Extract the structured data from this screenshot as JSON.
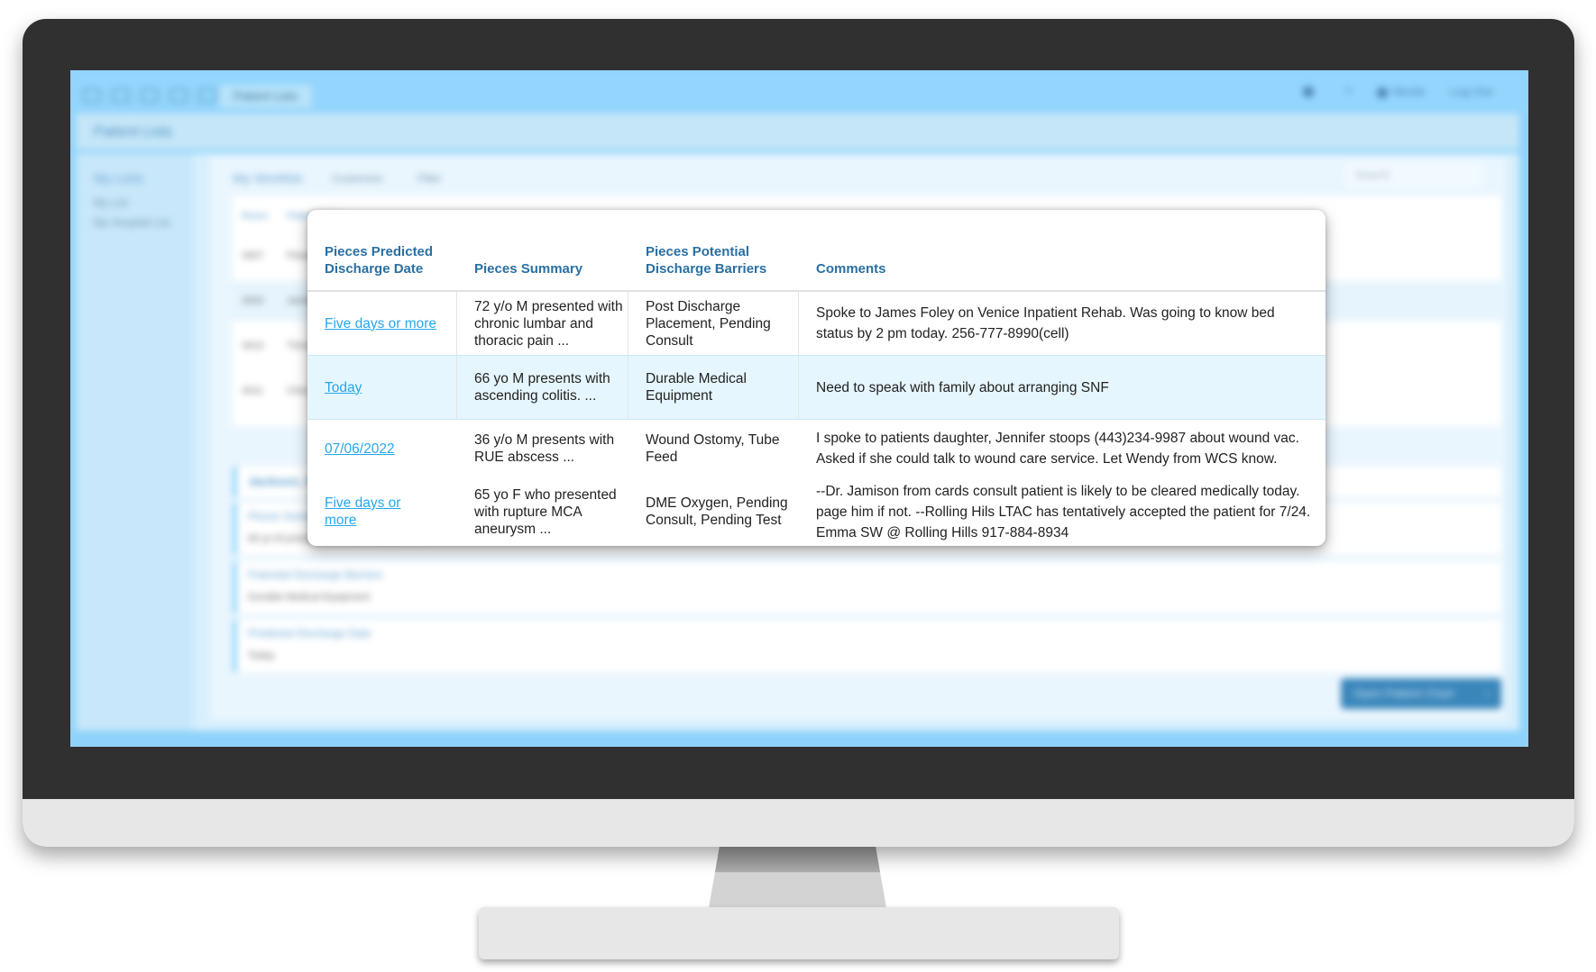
{
  "background_app": {
    "tab_label": "Patient Lists",
    "page_title": "Patient Lists",
    "top_right": {
      "user_label": "Nicole",
      "logout_label": "Log Out"
    },
    "sidebar": {
      "title": "My Lists",
      "items": [
        "My List",
        "My Hospital List"
      ]
    },
    "worklist": {
      "title": "My Worklist",
      "customize_label": "Customize",
      "filter_label": "Filter",
      "search_placeholder": "Search"
    },
    "table": {
      "headers": [
        "Room",
        "Patient Name"
      ],
      "rows": [
        {
          "room": "3407",
          "name": "Floan, C"
        },
        {
          "room": "3400",
          "name": "Jackson, F"
        },
        {
          "room": "3410",
          "name": "Thomas,"
        },
        {
          "room": "3411",
          "name": "Chen, K"
        }
      ]
    },
    "detail": {
      "patient_name": "Jackson, F",
      "cards": [
        {
          "label": "Pieces Summary",
          "value": "66 yo M presents with ascending colitis. ..."
        },
        {
          "label": "Potential Discharge Barriers",
          "value": "Durable Medical Equipment"
        },
        {
          "label": "Predicted Discharge Date",
          "value": "Today"
        }
      ],
      "open_chart_label": "Open Patient Chart"
    }
  },
  "popup": {
    "headers": {
      "discharge_date": "Pieces Predicted Discharge Date",
      "summary": "Pieces Summary",
      "barriers": "Pieces Potential Discharge Barriers",
      "comments": "Comments"
    },
    "rows": [
      {
        "discharge_date": "Five days or more",
        "summary": "72 y/o M presented with chronic lumbar and thoracic pain  ...",
        "barriers": "Post Discharge Placement, Pending Consult",
        "comments": "Spoke to James Foley on Venice Inpatient Rehab. Was going to know bed status by 2 pm today. 256-777-8990(cell)",
        "highlighted": false
      },
      {
        "discharge_date": "Today",
        "summary": "66 yo M presents with ascending colitis. ...",
        "barriers": "Durable Medical Equipment",
        "comments": "Need to speak with family about arranging SNF",
        "highlighted": true
      },
      {
        "discharge_date": "07/06/2022",
        "summary": "36 y/o M presents with RUE abscess  ...",
        "barriers": "Wound Ostomy, Tube Feed",
        "comments": "I spoke to patients daughter, Jennifer stoops (443)234-9987 about wound vac. Asked if she could talk to wound care service. Let Wendy from WCS know.",
        "highlighted": false
      },
      {
        "discharge_date": "Five days or more",
        "summary": "65 yo F who presented with rupture MCA aneurysm ...",
        "barriers": "DME Oxygen, Pending Consult, Pending Test",
        "comments": "--Dr. Jamison from cards consult patient is likely to be cleared medically today. page him if not. --Rolling Hils LTAC has tentatively accepted the patient for 7/24. Emma SW @ Rolling Hills 917-884-8934",
        "highlighted": false
      }
    ]
  },
  "colors": {
    "header_text": "#2a6fa2",
    "link": "#27a7ea",
    "highlight_row": "#e6f6fe",
    "bezel": "#303030",
    "screen_bg": "#8fd3fb",
    "button": "#3a86bb"
  }
}
